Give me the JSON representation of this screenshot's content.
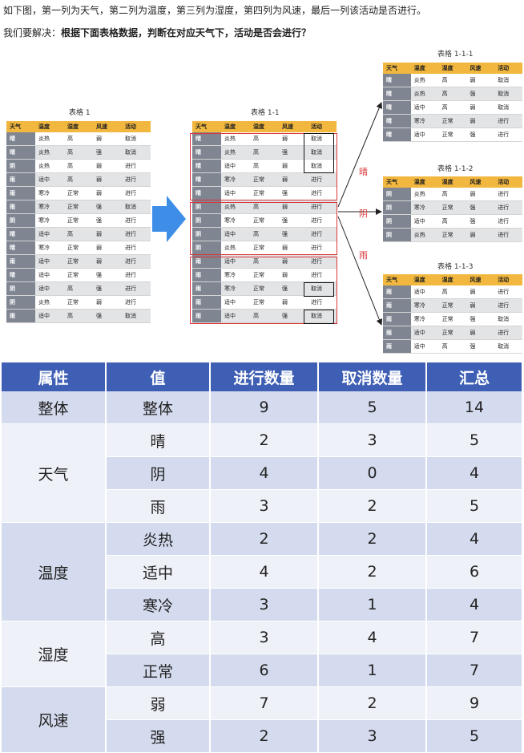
{
  "intro": {
    "line1": "如下图，第一列为天气，第二列为温度，第三列为湿度，第四列为风速，最后一列该活动是否进行。",
    "line2_prefix": "我们要解决：",
    "line2_bold": "根据下面表格数据，判断在对应天气下，活动是否会进行？"
  },
  "headers": [
    "天气",
    "温度",
    "湿度",
    "风速",
    "活动"
  ],
  "table1": {
    "title": "表格 1",
    "rows": [
      [
        "晴",
        "炎热",
        "高",
        "弱",
        "取消"
      ],
      [
        "晴",
        "炎热",
        "高",
        "强",
        "取消"
      ],
      [
        "阴",
        "炎热",
        "高",
        "弱",
        "进行"
      ],
      [
        "雨",
        "适中",
        "高",
        "弱",
        "进行"
      ],
      [
        "雨",
        "寒冷",
        "正常",
        "弱",
        "进行"
      ],
      [
        "雨",
        "寒冷",
        "正常",
        "强",
        "取消"
      ],
      [
        "阴",
        "寒冷",
        "正常",
        "强",
        "进行"
      ],
      [
        "晴",
        "适中",
        "高",
        "弱",
        "进行"
      ],
      [
        "晴",
        "寒冷",
        "正常",
        "弱",
        "进行"
      ],
      [
        "雨",
        "适中",
        "正常",
        "弱",
        "进行"
      ],
      [
        "晴",
        "适中",
        "正常",
        "强",
        "进行"
      ],
      [
        "阴",
        "适中",
        "高",
        "强",
        "进行"
      ],
      [
        "阴",
        "炎热",
        "正常",
        "弱",
        "进行"
      ],
      [
        "雨",
        "适中",
        "高",
        "强",
        "取消"
      ]
    ]
  },
  "table11": {
    "title": "表格 1-1",
    "rows": [
      [
        "晴",
        "炎热",
        "高",
        "弱",
        "取消"
      ],
      [
        "晴",
        "炎热",
        "高",
        "强",
        "取消"
      ],
      [
        "晴",
        "适中",
        "高",
        "弱",
        "取消"
      ],
      [
        "晴",
        "寒冷",
        "正常",
        "弱",
        "进行"
      ],
      [
        "晴",
        "适中",
        "正常",
        "强",
        "进行"
      ],
      [
        "阴",
        "炎热",
        "高",
        "弱",
        "进行"
      ],
      [
        "阴",
        "寒冷",
        "正常",
        "强",
        "进行"
      ],
      [
        "阴",
        "适中",
        "高",
        "强",
        "进行"
      ],
      [
        "阴",
        "炎热",
        "正常",
        "弱",
        "进行"
      ],
      [
        "雨",
        "适中",
        "高",
        "弱",
        "进行"
      ],
      [
        "雨",
        "寒冷",
        "正常",
        "弱",
        "进行"
      ],
      [
        "雨",
        "寒冷",
        "正常",
        "强",
        "取消"
      ],
      [
        "雨",
        "适中",
        "正常",
        "弱",
        "进行"
      ],
      [
        "雨",
        "适中",
        "高",
        "强",
        "取消"
      ]
    ]
  },
  "branch_labels": [
    "晴",
    "阴",
    "雨"
  ],
  "table111": {
    "title": "表格 1-1-1",
    "rows": [
      [
        "晴",
        "炎热",
        "高",
        "弱",
        "取消"
      ],
      [
        "晴",
        "炎热",
        "高",
        "强",
        "取消"
      ],
      [
        "晴",
        "适中",
        "高",
        "弱",
        "取消"
      ],
      [
        "晴",
        "寒冷",
        "正常",
        "弱",
        "进行"
      ],
      [
        "晴",
        "适中",
        "正常",
        "强",
        "进行"
      ]
    ]
  },
  "table112": {
    "title": "表格 1-1-2",
    "rows": [
      [
        "阴",
        "炎热",
        "高",
        "弱",
        "进行"
      ],
      [
        "阴",
        "寒冷",
        "正常",
        "强",
        "进行"
      ],
      [
        "阴",
        "适中",
        "高",
        "强",
        "进行"
      ],
      [
        "阴",
        "炎热",
        "正常",
        "弱",
        "进行"
      ]
    ]
  },
  "table113": {
    "title": "表格 1-1-3",
    "rows": [
      [
        "雨",
        "适中",
        "高",
        "弱",
        "进行"
      ],
      [
        "雨",
        "寒冷",
        "正常",
        "弱",
        "进行"
      ],
      [
        "雨",
        "寒冷",
        "正常",
        "强",
        "取消"
      ],
      [
        "雨",
        "适中",
        "正常",
        "弱",
        "进行"
      ],
      [
        "雨",
        "适中",
        "高",
        "强",
        "取消"
      ]
    ]
  },
  "summary": {
    "headers": [
      "属性",
      "值",
      "进行数量",
      "取消数量",
      "汇总"
    ],
    "overall": [
      "整体",
      "整体",
      "9",
      "5",
      "14"
    ],
    "groups": [
      {
        "attr": "天气",
        "rows": [
          [
            "晴",
            "2",
            "3",
            "5"
          ],
          [
            "阴",
            "4",
            "0",
            "4"
          ],
          [
            "雨",
            "3",
            "2",
            "5"
          ]
        ]
      },
      {
        "attr": "温度",
        "rows": [
          [
            "炎热",
            "2",
            "2",
            "4"
          ],
          [
            "适中",
            "4",
            "2",
            "6"
          ],
          [
            "寒冷",
            "3",
            "1",
            "4"
          ]
        ]
      },
      {
        "attr": "湿度",
        "rows": [
          [
            "高",
            "3",
            "4",
            "7"
          ],
          [
            "正常",
            "6",
            "1",
            "7"
          ]
        ]
      },
      {
        "attr": "风速",
        "rows": [
          [
            "弱",
            "7",
            "2",
            "9"
          ],
          [
            "强",
            "2",
            "3",
            "5"
          ]
        ]
      }
    ]
  },
  "colors": {
    "header_orange": "#f2b73e",
    "first_col_gray": "#7f8591",
    "group_red": "#d9373b",
    "arrow_blue": "#3e8ee8",
    "summary_header": "#3f5fb5",
    "summary_band": "#d4dbee"
  }
}
